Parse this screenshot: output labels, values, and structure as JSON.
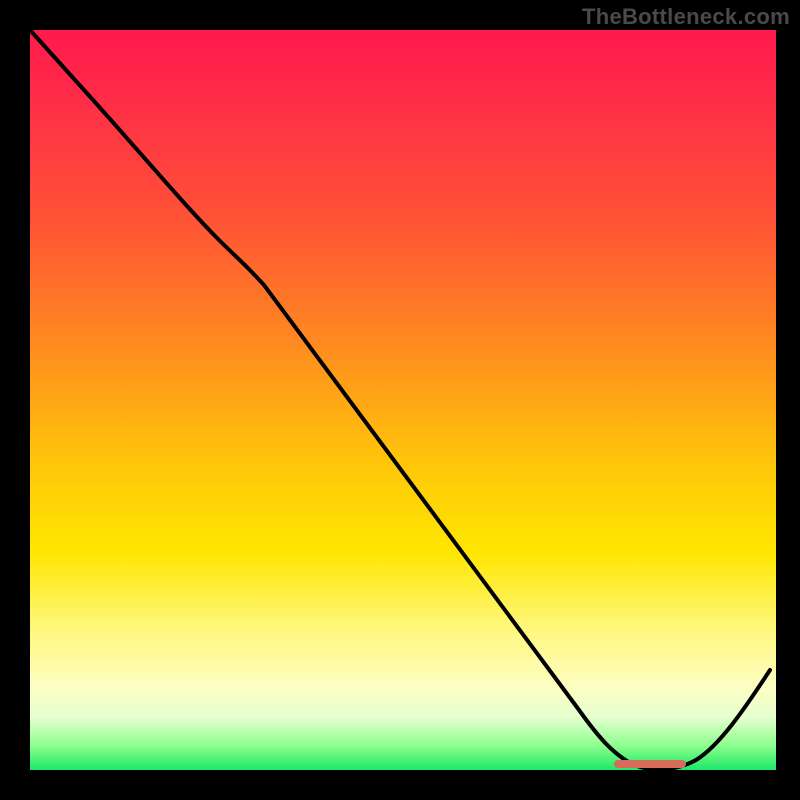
{
  "watermark": "TheBottleneck.com",
  "colors": {
    "background": "#000000",
    "gradient_top": "#ff1a4d",
    "gradient_mid": "#ffe600",
    "gradient_bottom": "#00e060",
    "curve": "#000000",
    "marker": "#d86a5a",
    "watermark_text": "#4a4a4a"
  },
  "chart_data": {
    "type": "line",
    "title": "",
    "xlabel": "",
    "ylabel": "",
    "xlim": [
      0,
      100
    ],
    "ylim": [
      0,
      100
    ],
    "x": [
      0,
      5,
      10,
      15,
      20,
      25,
      30,
      35,
      40,
      45,
      50,
      55,
      60,
      65,
      70,
      75,
      80,
      85,
      90,
      95,
      100
    ],
    "values": [
      100,
      95,
      90,
      85,
      80,
      74,
      66,
      58,
      50,
      42,
      34,
      26,
      18,
      10,
      4,
      1,
      0,
      0,
      3,
      10,
      20
    ],
    "annotations": [
      {
        "type": "marker",
        "x_start": 78,
        "x_end": 88,
        "y": 0
      }
    ]
  }
}
